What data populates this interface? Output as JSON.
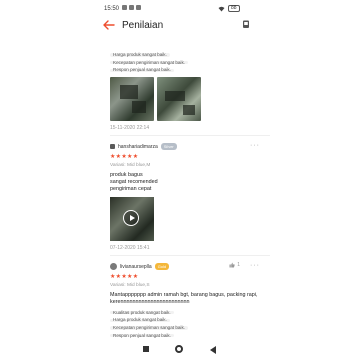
{
  "status_bar": {
    "time": "15:50",
    "battery": "88"
  },
  "header": {
    "title": "Penilaian",
    "back_icon": "back-arrow-icon",
    "camera_icon": "camera-icon",
    "accent_color": "#ee4d2d"
  },
  "review1": {
    "tags": [
      "Harga produk sangat baik.",
      "Kecepatan pengiriman sangat baik.",
      "Respon penjual sangat baik."
    ],
    "date": "15-11-2020 22:14"
  },
  "review2": {
    "username": "hanshariadimarza",
    "badge": "Silver",
    "stars": "★★★★★",
    "variant": "Variasi: Mid blue,M",
    "text": "produk bagus\nsangat recomended\npengiriman cepat",
    "date": "07-12-2020 15:41",
    "more": "···"
  },
  "review3": {
    "username": "livianaurseplla",
    "badge": "Gold",
    "likes": "1",
    "stars": "★★★★★",
    "variant": "Variasi: Mid blue,S",
    "text": "Mantappppppp admin ramah bgt, barang bagus, packing rapi, kerennnnnnnnnnnnnnnnnnnnnnn",
    "tags": [
      "Kualitas produk sangat baik.",
      "Harga produk sangat baik.",
      "Kecepatan pengiriman sangat baik.",
      "Respon penjual sangat baik."
    ],
    "more": "···"
  }
}
